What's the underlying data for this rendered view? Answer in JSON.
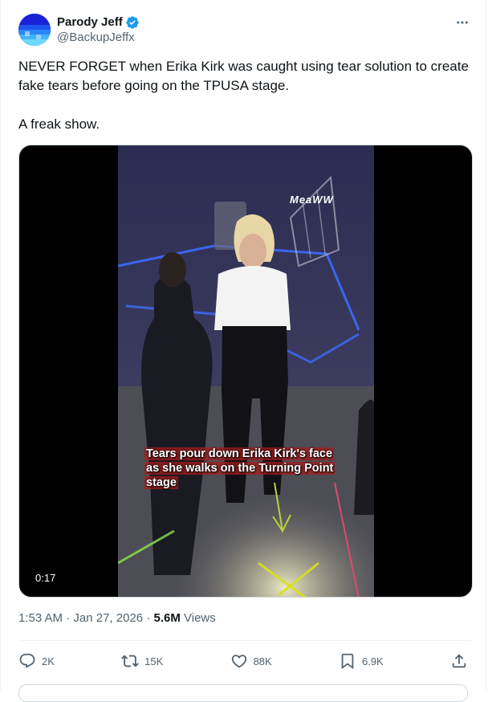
{
  "author": {
    "name": "Parody Jeff",
    "handle": "@BackupJeffx",
    "verified": true,
    "avatar_icon": "blue-gradient-avatar"
  },
  "tweet": {
    "text": "NEVER FORGET when Erika Kirk was caught using tear solution to create fake tears before going on the TPUSA stage.\n\nA freak show."
  },
  "media": {
    "type": "video",
    "duration": "0:17",
    "caption": "Tears pour down Erika Kirk's face as she walks on the Turning Point stage",
    "watermark": "MeaWW"
  },
  "meta": {
    "time": "1:53 AM",
    "date": "Jan 27, 2026",
    "views_count": "5.6M",
    "views_label": "Views"
  },
  "actions": {
    "replies": "2K",
    "reposts": "15K",
    "likes": "88K",
    "bookmarks": "6.9K"
  },
  "colors": {
    "text": "#0f1419",
    "secondary": "#536471",
    "verified": "#1d9bf0",
    "border": "#eff3f4"
  }
}
